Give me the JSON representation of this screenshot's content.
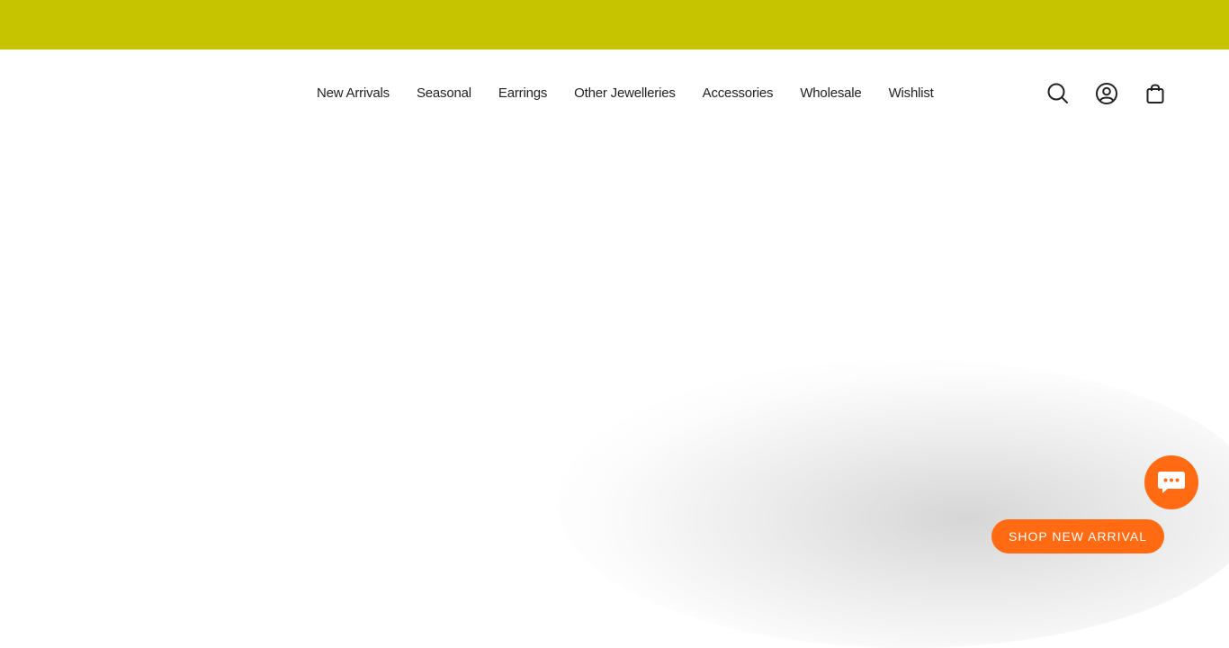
{
  "colors": {
    "announcement_bar": "#c6c400",
    "accent": "#ff6a13",
    "nav_text": "#222222",
    "background": "#ffffff"
  },
  "header": {
    "nav": [
      {
        "label": "New Arrivals"
      },
      {
        "label": "Seasonal"
      },
      {
        "label": "Earrings"
      },
      {
        "label": "Other Jewelleries"
      },
      {
        "label": "Accessories"
      },
      {
        "label": "Wholesale"
      },
      {
        "label": "Wishlist"
      }
    ],
    "icons": [
      "search-icon",
      "account-icon",
      "cart-icon"
    ]
  },
  "chat": {
    "icon": "chat-bubble-icon"
  },
  "cta": {
    "label": "SHOP NEW ARRIVAL"
  }
}
